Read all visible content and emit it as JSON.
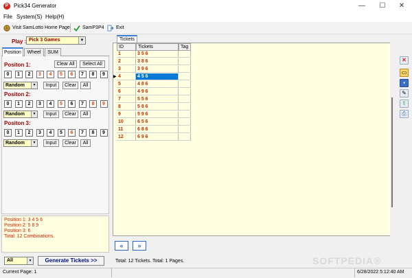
{
  "window": {
    "title": "Pick34 Generator",
    "minimize": "—",
    "maximize": "☐",
    "close": "✕"
  },
  "menu": [
    "File",
    "System(S)",
    "Help(H)"
  ],
  "toolbar": {
    "visit": "Visit SamLotto Home Page",
    "samp": "SamP3P4",
    "exit": "Exit"
  },
  "play": {
    "label": "Play :",
    "value": "Pick 3 Games"
  },
  "tabs": [
    "Position",
    "Wheel",
    "SUM"
  ],
  "positions": [
    {
      "label": "Positon 1:",
      "digits": [
        "0",
        "1",
        "2",
        "3",
        "4",
        "5",
        "6",
        "7",
        "8",
        "9"
      ],
      "selected": [
        3,
        4,
        5,
        6
      ]
    },
    {
      "label": "Positon 2:",
      "digits": [
        "0",
        "1",
        "2",
        "3",
        "4",
        "5",
        "6",
        "7",
        "8",
        "9"
      ],
      "selected": [
        5,
        8,
        9
      ]
    },
    {
      "label": "Positon 3:",
      "digits": [
        "0",
        "1",
        "2",
        "3",
        "4",
        "5",
        "6",
        "7",
        "8",
        "9"
      ],
      "selected": [
        6
      ]
    }
  ],
  "buttons": {
    "clear_all": "Clear All",
    "select_all": "Select All",
    "random": "Random",
    "input": "Input",
    "clear": "Clear",
    "all": "All"
  },
  "summary": [
    "Position 1:  3 4 5 6",
    "Position 2:  5 8 9",
    "Position 3:  6",
    "Total: 12 Combinations."
  ],
  "tickets_tab": "Tickets",
  "grid": {
    "headers": [
      "ID",
      "Tickets",
      "Tag"
    ],
    "rows": [
      [
        "1",
        "3 5 6",
        ""
      ],
      [
        "2",
        "3 8 6",
        ""
      ],
      [
        "3",
        "3 9 6",
        ""
      ],
      [
        "4",
        "4 5 6",
        ""
      ],
      [
        "5",
        "4 8 6",
        ""
      ],
      [
        "6",
        "4 9 6",
        ""
      ],
      [
        "7",
        "5 5 6",
        ""
      ],
      [
        "8",
        "5 8 6",
        ""
      ],
      [
        "9",
        "5 9 6",
        ""
      ],
      [
        "10",
        "6 5 6",
        ""
      ],
      [
        "11",
        "6 8 6",
        ""
      ],
      [
        "12",
        "6 9 6",
        ""
      ]
    ],
    "selected_row": 4
  },
  "nav": {
    "prev": "«",
    "next": "»"
  },
  "bottom": {
    "filter": "All",
    "generate": "Generate Tickets >>",
    "totals": "Total: 12 Tickets.  Total: 1 Pages."
  },
  "status": {
    "page": "Current Page: 1",
    "datetime": "6/28/2022 5:12:40 AM"
  },
  "watermark": "SOFTPEDIA®"
}
